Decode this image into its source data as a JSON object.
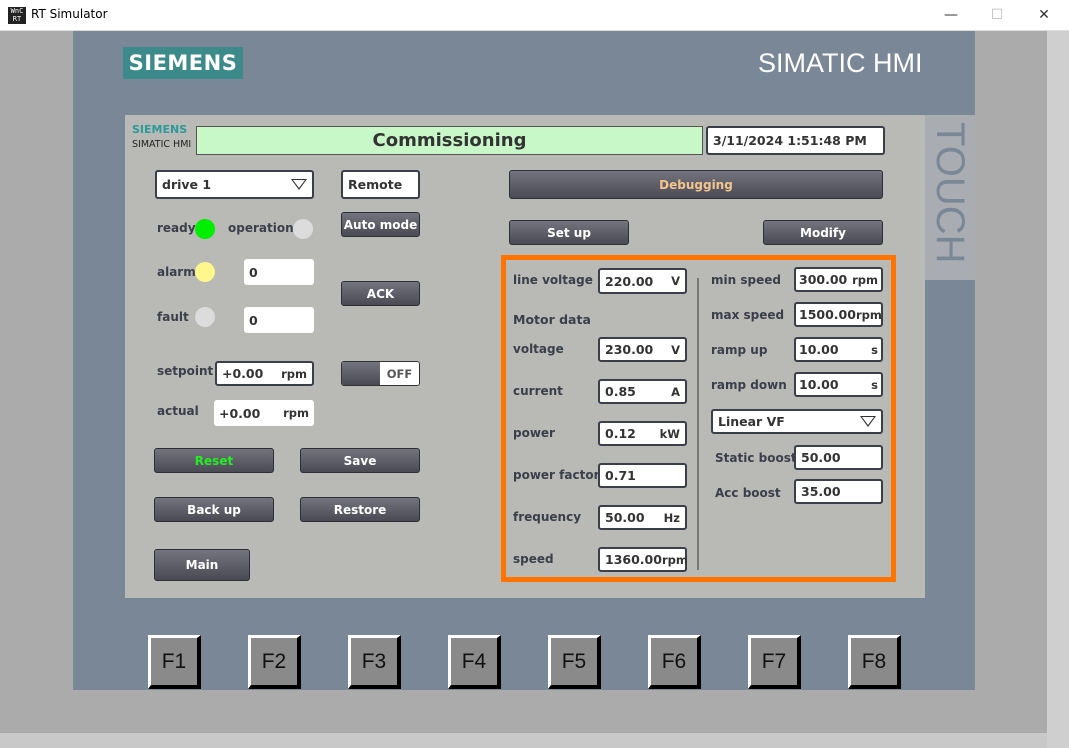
{
  "window": {
    "title": "RT Simulator",
    "app_icon": "WinCC RT",
    "minimize": "—",
    "maximize": "☐",
    "close": "✕"
  },
  "device": {
    "brand": "SIEMENS",
    "model": "SIMATIC HMI",
    "touch": "TOUCH",
    "function_keys": [
      "F1",
      "F2",
      "F3",
      "F4",
      "F5",
      "F6",
      "F7",
      "F8"
    ]
  },
  "header": {
    "brand": "SIEMENS",
    "sub": "SIMATIC HMI",
    "title": "Commissioning",
    "datetime": "3/11/2024 1:51:48 PM"
  },
  "left": {
    "drive_select": "drive 1",
    "mode_display": "Remote",
    "auto_mode": "Auto mode",
    "ready": "ready",
    "operation": "operation",
    "alarm": "alarm",
    "fault": "fault",
    "alarm_value": "0",
    "fault_value": "0",
    "ack": "ACK",
    "setpoint_label": "setpoint",
    "setpoint_value": "+0.00",
    "setpoint_unit": "rpm",
    "actual_label": "actual",
    "actual_value": "+0.00",
    "actual_unit": "rpm",
    "toggle": "OFF",
    "reset": "Reset",
    "save": "Save",
    "backup": "Back up",
    "restore": "Restore",
    "main": "Main",
    "colors": {
      "ready": "#00ee00",
      "operation": "#dcdcdc",
      "alarm": "#fff68c",
      "fault": "#dcdcdc"
    }
  },
  "right": {
    "debugging": "Debugging",
    "setup": "Set up",
    "modify": "Modify",
    "line_voltage": {
      "label": "line voltage",
      "value": "220.00",
      "unit": "V"
    },
    "motor_data": "Motor data",
    "motor": [
      {
        "label": "voltage",
        "value": "230.00",
        "unit": "V"
      },
      {
        "label": "current",
        "value": "0.85",
        "unit": "A"
      },
      {
        "label": "power",
        "value": "0.12",
        "unit": "kW"
      },
      {
        "label": "power factor",
        "value": "0.71",
        "unit": ""
      },
      {
        "label": "frequency",
        "value": "50.00",
        "unit": "Hz"
      },
      {
        "label": "speed",
        "value": "1360.00",
        "unit": "rpm"
      }
    ],
    "drive_params": [
      {
        "label": "min speed",
        "value": "300.00",
        "unit": "rpm"
      },
      {
        "label": "max speed",
        "value": "1500.00",
        "unit": "rpm"
      },
      {
        "label": "ramp up",
        "value": "10.00",
        "unit": "s"
      },
      {
        "label": "ramp down",
        "value": "10.00",
        "unit": "s"
      }
    ],
    "control_mode": "Linear VF",
    "static_boost": {
      "label": "Static boost",
      "value": "50.00"
    },
    "acc_boost": {
      "label": "Acc boost",
      "value": "35.00"
    }
  }
}
